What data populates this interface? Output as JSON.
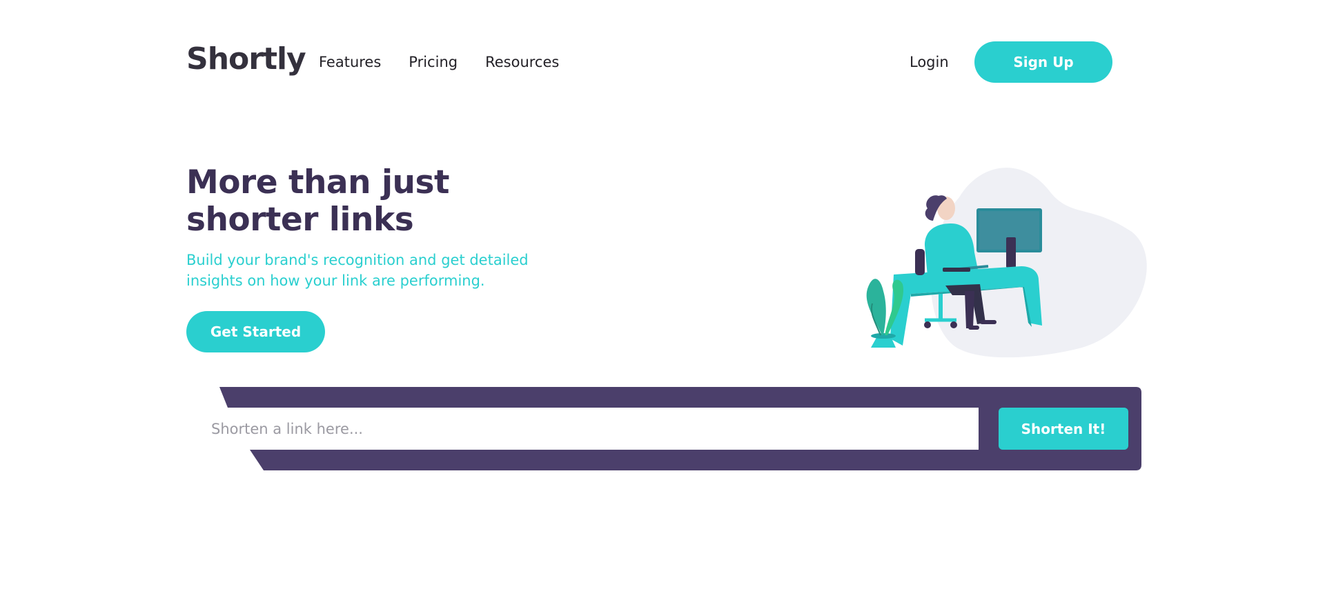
{
  "header": {
    "logo": "Shortly",
    "nav": [
      "Features",
      "Pricing",
      "Resources"
    ],
    "login_label": "Login",
    "signup_label": "Sign Up"
  },
  "hero": {
    "title": "More than just shorter links",
    "subtitle": "Build your brand's recognition and get detailed insights on how your link are performing.",
    "cta_label": "Get Started"
  },
  "shorten": {
    "placeholder": "Shorten a link here...",
    "value": "",
    "button_label": "Shorten It!"
  },
  "colors": {
    "accent": "#2acfcf",
    "dark_violet": "#3b3054",
    "bar": "#4b3f6b",
    "text_dark": "#34313d"
  },
  "icons": [
    "working-person-illustration"
  ]
}
